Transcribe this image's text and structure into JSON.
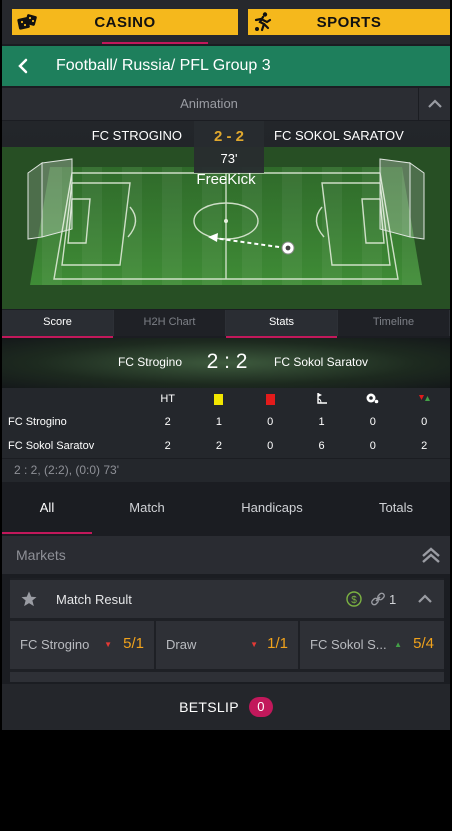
{
  "topnav": {
    "casino_label": "CASINO",
    "sports_label": "SPORTS"
  },
  "header": {
    "breadcrumb": "Football/ Russia/ PFL Group 3"
  },
  "animation": {
    "label": "Animation"
  },
  "match": {
    "home": "FC STROGINO",
    "away": "FC SOKOL SARATOV",
    "score": "2 - 2",
    "minute": "73'",
    "event": "FreeKick"
  },
  "stat_tabs": [
    {
      "label": "Score"
    },
    {
      "label": "H2H Chart"
    },
    {
      "label": "Stats"
    },
    {
      "label": "Timeline"
    }
  ],
  "scoreboard": {
    "home": "FC Strogino",
    "away": "FC Sokol Saratov",
    "score": "2 : 2"
  },
  "stats": {
    "columns": [
      "HT",
      "yellow-card-icon",
      "red-card-icon",
      "corner-icon",
      "penalty-icon",
      "substitution-icon"
    ],
    "ht_label": "HT",
    "rows": [
      {
        "team": "FC Strogino",
        "values": [
          "2",
          "1",
          "0",
          "1",
          "0",
          "0"
        ]
      },
      {
        "team": "FC Sokol Saratov",
        "values": [
          "2",
          "2",
          "0",
          "6",
          "0",
          "2"
        ]
      }
    ],
    "summary": "2 : 2, (2:2), (0:0)   73'"
  },
  "market_tabs": [
    {
      "label": "All"
    },
    {
      "label": "Match"
    },
    {
      "label": "Handicaps"
    },
    {
      "label": "Totals"
    }
  ],
  "markets": {
    "label": "Markets"
  },
  "market": {
    "name": "Match Result",
    "count": "1",
    "outcomes": [
      {
        "name": "FC Strogino",
        "odds": "5/1",
        "trend": "down"
      },
      {
        "name": "Draw",
        "odds": "1/1",
        "trend": "down"
      },
      {
        "name": "FC Sokol S...",
        "odds": "5/4",
        "trend": "up"
      }
    ]
  },
  "betslip": {
    "label": "BETSLIP",
    "count": "0"
  },
  "colors": {
    "accent": "#c2185b",
    "brand_yellow": "#f5b81c",
    "header_green": "#1e7f5c",
    "odds_orange": "#f0a21c",
    "trend_down": "#e53935",
    "trend_up": "#43a047"
  }
}
